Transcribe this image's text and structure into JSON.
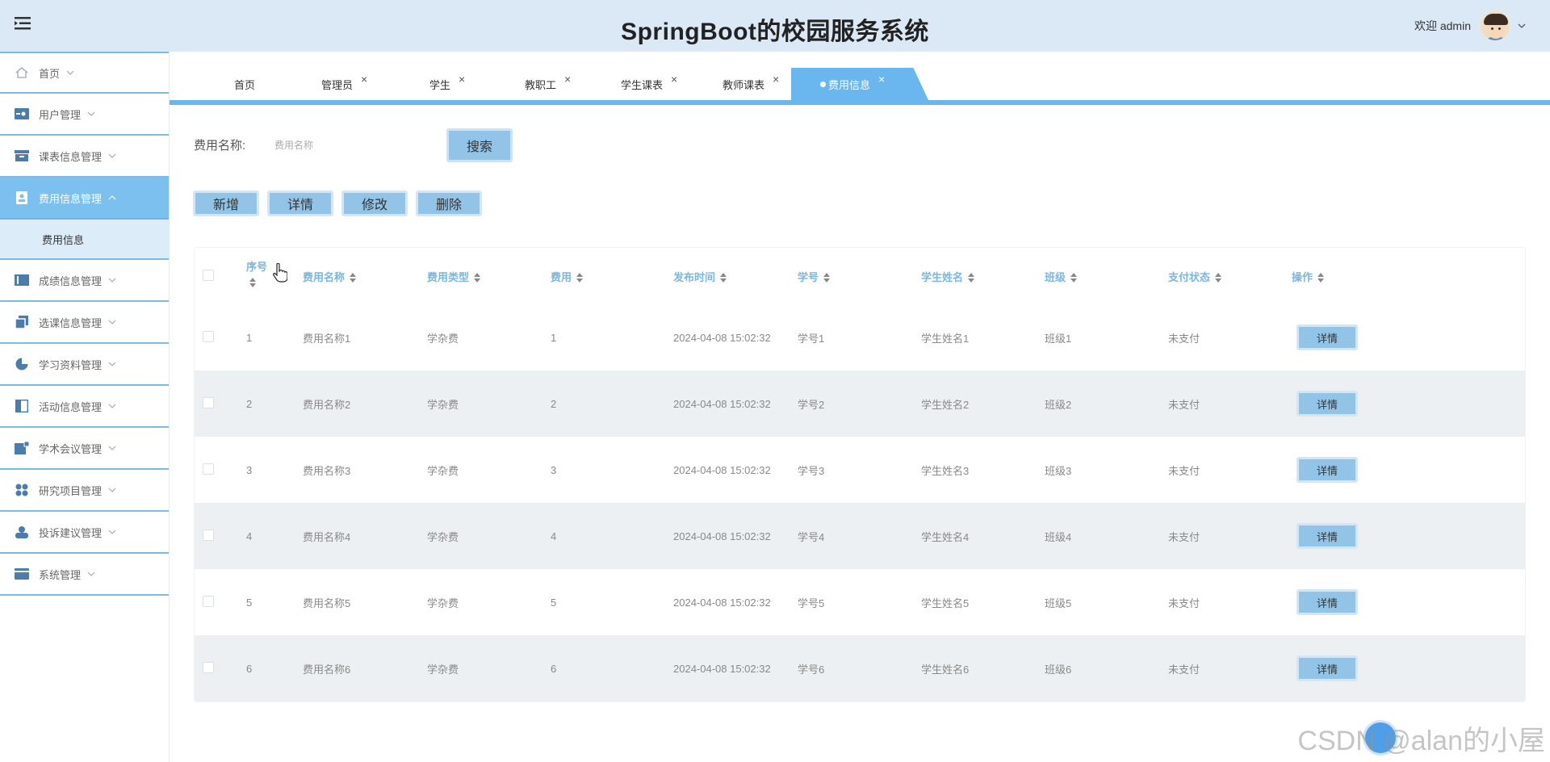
{
  "header": {
    "title": "SpringBoot的校园服务系统",
    "welcome": "欢迎 admin"
  },
  "sidebar": {
    "items": [
      {
        "label": "首页",
        "icon": "home-icon"
      },
      {
        "label": "用户管理",
        "icon": "user-card-icon"
      },
      {
        "label": "课表信息管理",
        "icon": "archive-icon"
      },
      {
        "label": "费用信息管理",
        "icon": "contact-book-icon"
      },
      {
        "label": "成绩信息管理",
        "icon": "book-icon"
      },
      {
        "label": "选课信息管理",
        "icon": "copy-icon"
      },
      {
        "label": "学习资料管理",
        "icon": "pie-icon"
      },
      {
        "label": "活动信息管理",
        "icon": "panel-icon"
      },
      {
        "label": "学术会议管理",
        "icon": "image-icon"
      },
      {
        "label": "研究项目管理",
        "icon": "grid-dots-icon"
      },
      {
        "label": "投诉建议管理",
        "icon": "people-icon"
      },
      {
        "label": "系统管理",
        "icon": "wallet-icon"
      }
    ],
    "submenu": {
      "label": "费用信息"
    }
  },
  "tabs": [
    {
      "label": "首页",
      "closable": false
    },
    {
      "label": "管理员",
      "closable": true
    },
    {
      "label": "学生",
      "closable": true
    },
    {
      "label": "教职工",
      "closable": true
    },
    {
      "label": "学生课表",
      "closable": true
    },
    {
      "label": "教师课表",
      "closable": true
    },
    {
      "label": "费用信息",
      "closable": true,
      "active": true
    }
  ],
  "search": {
    "label": "费用名称:",
    "placeholder": "费用名称",
    "button": "搜索"
  },
  "actions": {
    "add": "新增",
    "detail": "详情",
    "edit": "修改",
    "delete": "删除"
  },
  "table": {
    "columns": [
      "序号",
      "费用名称",
      "费用类型",
      "费用",
      "发布时间",
      "学号",
      "学生姓名",
      "班级",
      "支付状态",
      "操作"
    ],
    "rows": [
      [
        "1",
        "费用名称1",
        "学杂费",
        "1",
        "2024-04-08 15:02:32",
        "学号1",
        "学生姓名1",
        "班级1",
        "未支付"
      ],
      [
        "2",
        "费用名称2",
        "学杂费",
        "2",
        "2024-04-08 15:02:32",
        "学号2",
        "学生姓名2",
        "班级2",
        "未支付"
      ],
      [
        "3",
        "费用名称3",
        "学杂费",
        "3",
        "2024-04-08 15:02:32",
        "学号3",
        "学生姓名3",
        "班级3",
        "未支付"
      ],
      [
        "4",
        "费用名称4",
        "学杂费",
        "4",
        "2024-04-08 15:02:32",
        "学号4",
        "学生姓名4",
        "班级4",
        "未支付"
      ],
      [
        "5",
        "费用名称5",
        "学杂费",
        "5",
        "2024-04-08 15:02:32",
        "学号5",
        "学生姓名5",
        "班级5",
        "未支付"
      ],
      [
        "6",
        "费用名称6",
        "学杂费",
        "6",
        "2024-04-08 15:02:32",
        "学号6",
        "学生姓名6",
        "班级6",
        "未支付"
      ]
    ],
    "row_action": "详情"
  },
  "watermark": "CSDN @alan的小屋",
  "colors": {
    "header_bg": "#dbe8f5",
    "accent": "#6ab7ef",
    "button": "#91c4e6",
    "sort_header": "#7ab6dd"
  }
}
